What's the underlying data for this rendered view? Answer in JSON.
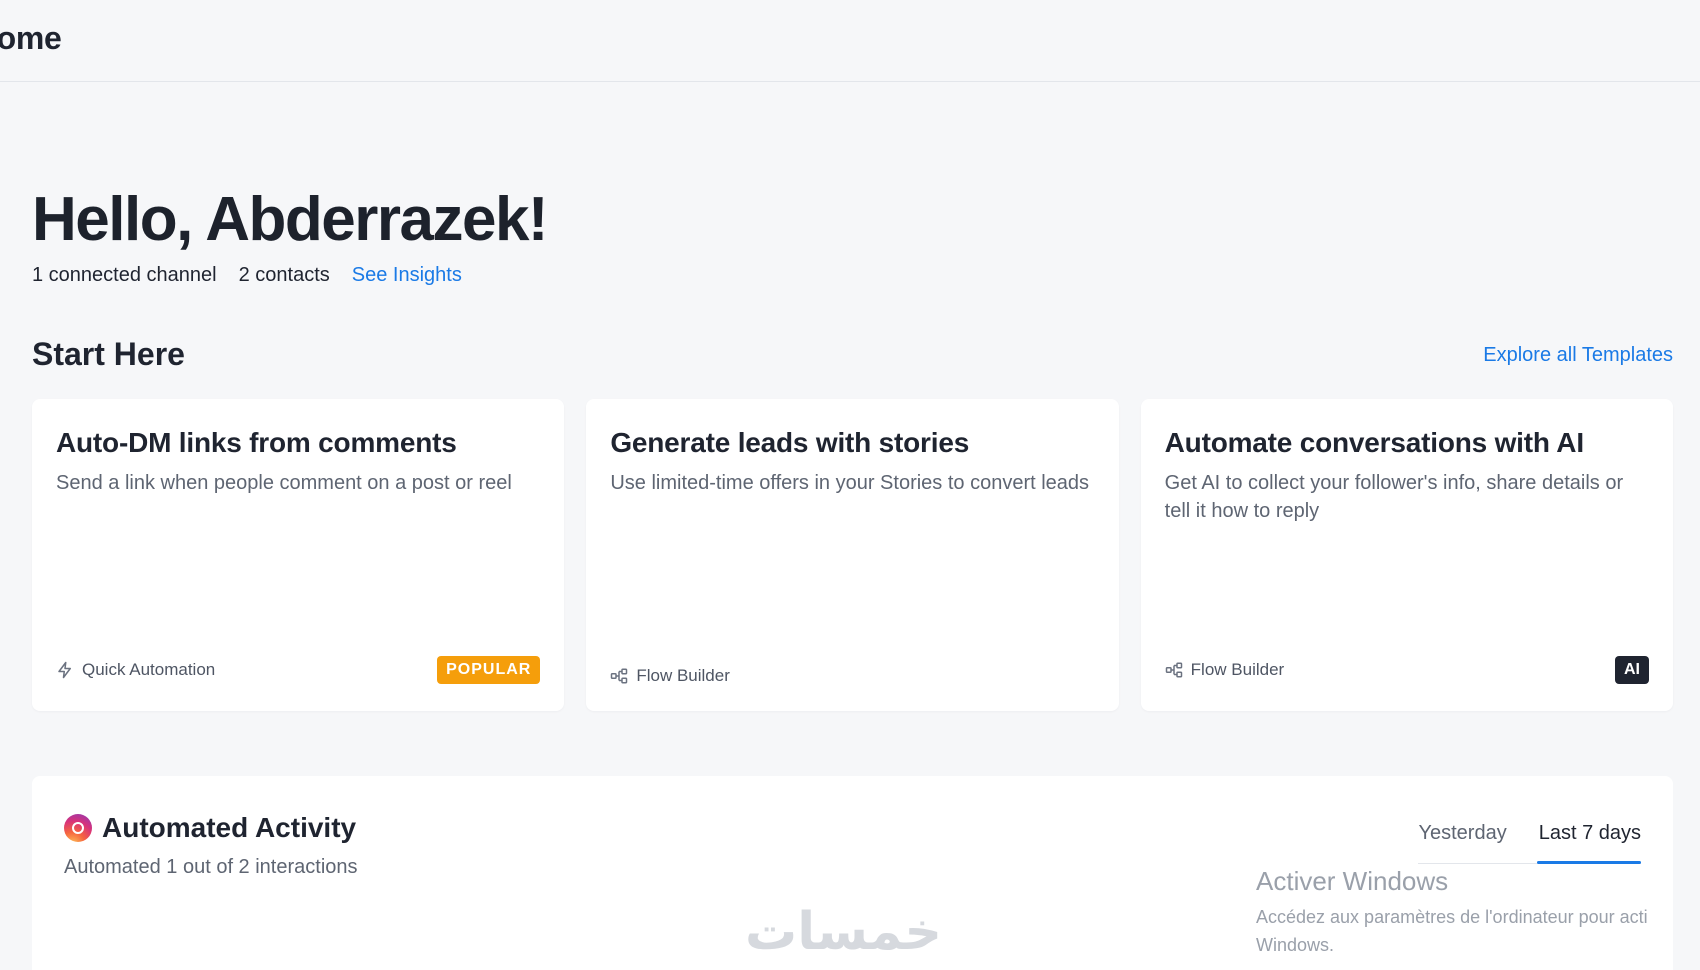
{
  "header": {
    "title": "lome"
  },
  "greeting": {
    "title": "Hello, Abderrazek!",
    "channels": "1 connected channel",
    "contacts": "2 contacts",
    "insights_link": "See Insights"
  },
  "start_here": {
    "title": "Start Here",
    "explore_link": "Explore all Templates",
    "cards": [
      {
        "title": "Auto-DM links from comments",
        "description": "Send a link when people comment on a post or reel",
        "type": "Quick Automation",
        "type_icon": "lightning-icon",
        "badge": "POPULAR"
      },
      {
        "title": "Generate leads with stories",
        "description": "Use limited-time offers in your Stories to convert leads",
        "type": "Flow Builder",
        "type_icon": "flow-icon",
        "badge": ""
      },
      {
        "title": "Automate conversations with AI",
        "description": "Get AI to collect your follower's info, share details or tell it how to reply",
        "type": "Flow Builder",
        "type_icon": "flow-icon",
        "badge": "AI"
      }
    ]
  },
  "activity": {
    "title": "Automated Activity",
    "subtitle": "Automated 1 out of 2 interactions",
    "icon": "instagram-icon",
    "tabs": [
      {
        "label": "Yesterday",
        "active": false
      },
      {
        "label": "Last 7 days",
        "active": true
      }
    ]
  },
  "watermarks": {
    "windows_title": "Activer Windows",
    "windows_line1": "Accédez aux paramètres de l'ordinateur pour acti",
    "windows_line2": "Windows.",
    "site": "خمسات"
  },
  "colors": {
    "accent": "#1a7ae6",
    "popular_badge": "#f59e0b",
    "ai_badge": "#1f2430",
    "background": "#f6f7f9"
  }
}
